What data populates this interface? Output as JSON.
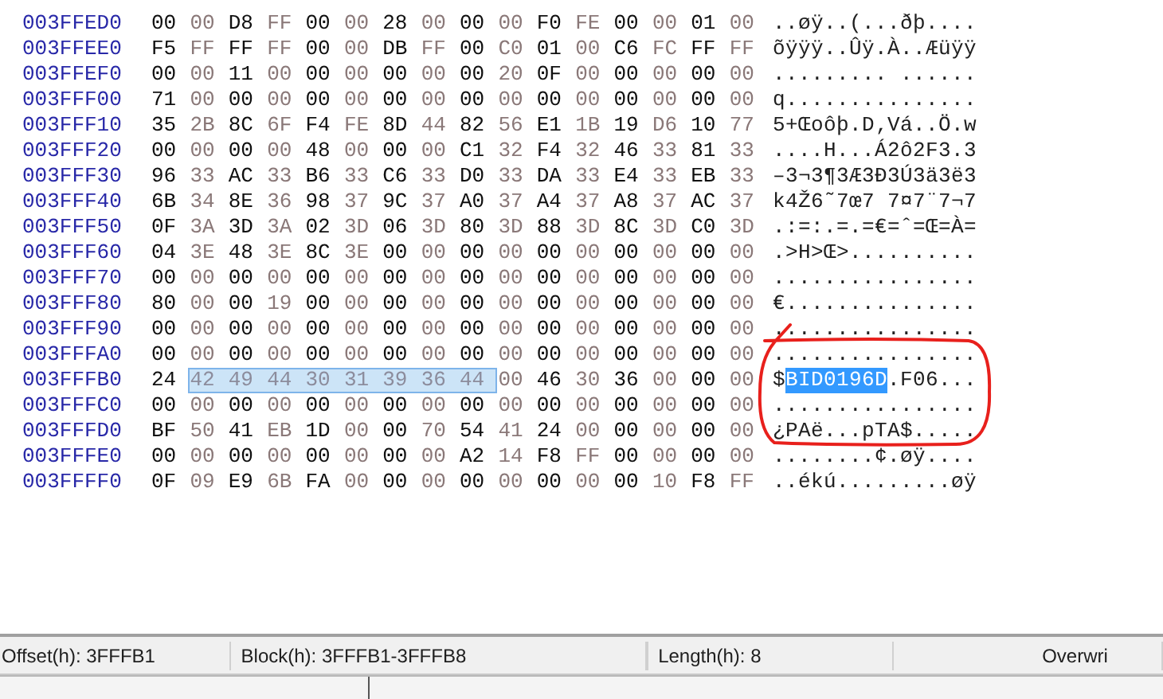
{
  "rows": [
    {
      "offset": "003FFED0",
      "hex": [
        {
          "text": "00 00 D8 FF 00 00 28 00 00 00 F0 FE 00 00 01 00",
          "selected": false
        }
      ],
      "ascii": [
        {
          "text": "..øÿ..(...ðþ....",
          "selected": false
        }
      ]
    },
    {
      "offset": "003FFEE0",
      "hex": [
        {
          "text": "F5 FF FF FF 00 00 DB FF 00 C0 01 00 C6 FC FF FF",
          "selected": false
        }
      ],
      "ascii": [
        {
          "text": "õÿÿÿ..Ûÿ.À..Æüÿÿ",
          "selected": false
        }
      ]
    },
    {
      "offset": "003FFEF0",
      "hex": [
        {
          "text": "00 00 11 00 00 00 00 00 00 20 0F 00 00 00 00 00",
          "selected": false
        }
      ],
      "ascii": [
        {
          "text": "......... ......",
          "selected": false
        }
      ]
    },
    {
      "offset": "003FFF00",
      "hex": [
        {
          "text": "71 00 00 00 00 00 00 00 00 00 00 00 00 00 00 00",
          "selected": false
        }
      ],
      "ascii": [
        {
          "text": "q...............",
          "selected": false
        }
      ]
    },
    {
      "offset": "003FFF10",
      "hex": [
        {
          "text": "35 2B 8C 6F F4 FE 8D 44 82 56 E1 1B 19 D6 10 77",
          "selected": false
        }
      ],
      "ascii": [
        {
          "text": "5+Œoôþ.D‚Vá..Ö.w",
          "selected": false
        }
      ]
    },
    {
      "offset": "003FFF20",
      "hex": [
        {
          "text": "00 00 00 00 48 00 00 00 C1 32 F4 32 46 33 81 33",
          "selected": false
        }
      ],
      "ascii": [
        {
          "text": "....H...Á2ô2F3.3",
          "selected": false
        }
      ]
    },
    {
      "offset": "003FFF30",
      "hex": [
        {
          "text": "96 33 AC 33 B6 33 C6 33 D0 33 DA 33 E4 33 EB 33",
          "selected": false
        }
      ],
      "ascii": [
        {
          "text": "–3¬3¶3Æ3Ð3Ú3ä3ë3",
          "selected": false
        }
      ]
    },
    {
      "offset": "003FFF40",
      "hex": [
        {
          "text": "6B 34 8E 36 98 37 9C 37 A0 37 A4 37 A8 37 AC 37",
          "selected": false
        }
      ],
      "ascii": [
        {
          "text": "k4Ž6˜7œ7 7¤7¨7¬7",
          "selected": false
        }
      ]
    },
    {
      "offset": "003FFF50",
      "hex": [
        {
          "text": "0F 3A 3D 3A 02 3D 06 3D 80 3D 88 3D 8C 3D C0 3D",
          "selected": false
        }
      ],
      "ascii": [
        {
          "text": ".:=:.=.=€=ˆ=Œ=À=",
          "selected": false
        }
      ]
    },
    {
      "offset": "003FFF60",
      "hex": [
        {
          "text": "04 3E 48 3E 8C 3E 00 00 00 00 00 00 00 00 00 00",
          "selected": false
        }
      ],
      "ascii": [
        {
          "text": ".>H>Œ>..........",
          "selected": false
        }
      ]
    },
    {
      "offset": "003FFF70",
      "hex": [
        {
          "text": "00 00 00 00 00 00 00 00 00 00 00 00 00 00 00 00",
          "selected": false
        }
      ],
      "ascii": [
        {
          "text": "................",
          "selected": false
        }
      ]
    },
    {
      "offset": "003FFF80",
      "hex": [
        {
          "text": "80 00 00 19 00 00 00 00 00 00 00 00 00 00 00 00",
          "selected": false
        }
      ],
      "ascii": [
        {
          "text": "€...............",
          "selected": false
        }
      ]
    },
    {
      "offset": "003FFF90",
      "hex": [
        {
          "text": "00 00 00 00 00 00 00 00 00 00 00 00 00 00 00 00",
          "selected": false
        }
      ],
      "ascii": [
        {
          "text": "................",
          "selected": false
        }
      ]
    },
    {
      "offset": "003FFFA0",
      "hex": [
        {
          "text": "00 00 00 00 00 00 00 00 00 00 00 00 00 00 00 00",
          "selected": false
        }
      ],
      "ascii": [
        {
          "text": "................",
          "selected": false
        }
      ]
    },
    {
      "offset": "003FFFB0",
      "hex": [
        {
          "text": "24",
          "selected": false
        },
        {
          "text": "42 49 44 30 31 39 36 44",
          "selected": true
        },
        {
          "text": "00 46 30 36 00 00 00",
          "selected": false
        }
      ],
      "ascii": [
        {
          "text": "$",
          "selected": false
        },
        {
          "text": "BID0196D",
          "selected": true
        },
        {
          "text": ".F06...",
          "selected": false
        }
      ]
    },
    {
      "offset": "003FFFC0",
      "hex": [
        {
          "text": "00 00 00 00 00 00 00 00 00 00 00 00 00 00 00 00",
          "selected": false
        }
      ],
      "ascii": [
        {
          "text": "................",
          "selected": false
        }
      ]
    },
    {
      "offset": "003FFFD0",
      "hex": [
        {
          "text": "BF 50 41 EB 1D 00 00 70 54 41 24 00 00 00 00 00",
          "selected": false
        }
      ],
      "ascii": [
        {
          "text": "¿PAë...pTA$.....",
          "selected": false
        }
      ]
    },
    {
      "offset": "003FFFE0",
      "hex": [
        {
          "text": "00 00 00 00 00 00 00 00 A2 14 F8 FF 00 00 00 00",
          "selected": false
        }
      ],
      "ascii": [
        {
          "text": "........¢.øÿ....",
          "selected": false
        }
      ]
    },
    {
      "offset": "003FFFF0",
      "hex": [
        {
          "text": "0F 09 E9 6B FA 00 00 00 00 00 00 00 00 10 F8 FF",
          "selected": false
        }
      ],
      "ascii": [
        {
          "text": "..ékú.........øÿ",
          "selected": false
        }
      ]
    }
  ],
  "status_bar": [
    {
      "text": "Offset(h): 3FFFB1"
    },
    {
      "text": "Block(h): 3FFFB1-3FFFB8"
    },
    {
      "text": "Length(h): 8"
    },
    {
      "text": "Overwri"
    }
  ]
}
